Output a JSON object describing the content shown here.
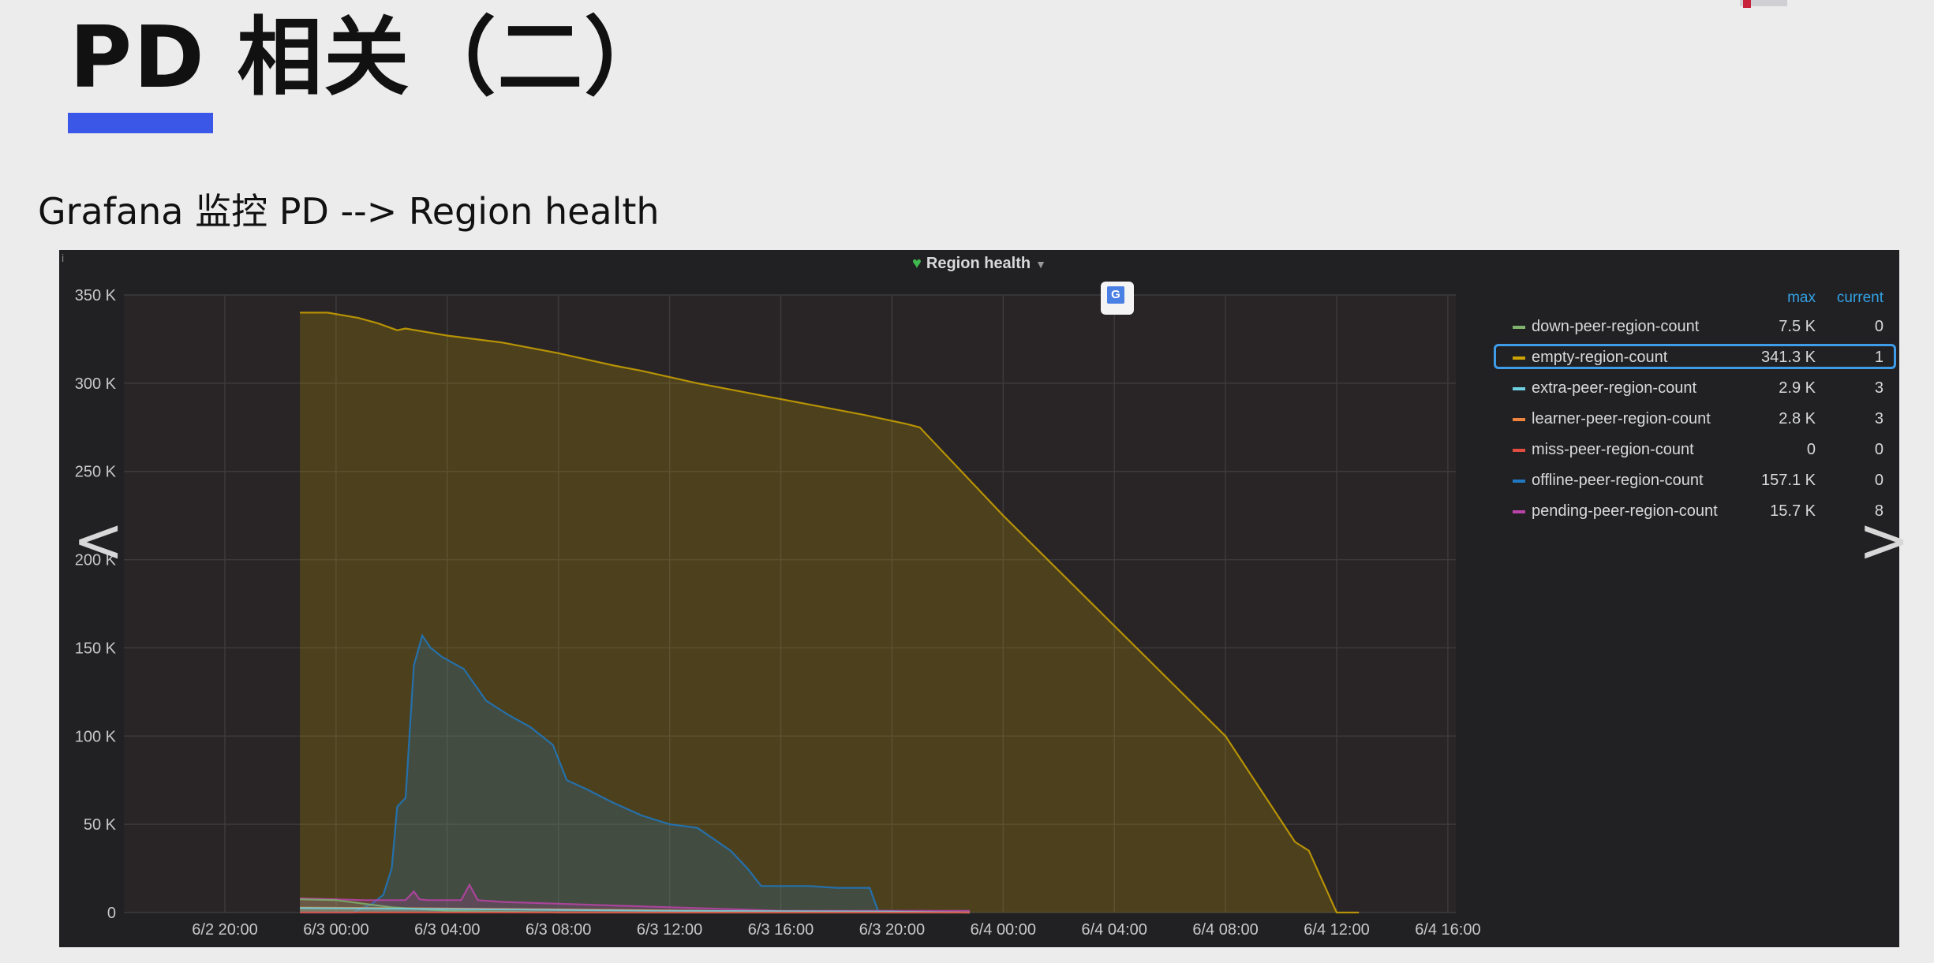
{
  "slide": {
    "title": "PD 相关（二）",
    "subtitle": "Grafana 监控 PD --> Region health"
  },
  "panel": {
    "title": "Region health",
    "legend_headers": {
      "max": "max",
      "current": "current"
    }
  },
  "chart_data": {
    "type": "area",
    "x_ticks": [
      "6/2 20:00",
      "6/3 00:00",
      "6/3 04:00",
      "6/3 08:00",
      "6/3 12:00",
      "6/3 16:00",
      "6/3 20:00",
      "6/4 00:00",
      "6/4 04:00",
      "6/4 08:00",
      "6/4 12:00",
      "6/4 16:00"
    ],
    "y_ticks": [
      "0",
      "50 K",
      "100 K",
      "150 K",
      "200 K",
      "250 K",
      "300 K",
      "350 K"
    ],
    "ylim": [
      0,
      350000
    ],
    "x_hours_range": [
      -1.3,
      22.8
    ],
    "x_origin_label": "6/3 00:00",
    "series": [
      {
        "name": "down-peer-region-count",
        "color": "#7eb26d",
        "max": "7.5 K",
        "current": "0",
        "points": [
          [
            -1.3,
            7500
          ],
          [
            0,
            7000
          ],
          [
            2,
            3000
          ],
          [
            4,
            1000
          ],
          [
            6,
            500
          ],
          [
            8,
            0
          ],
          [
            22.8,
            0
          ]
        ]
      },
      {
        "name": "empty-region-count",
        "color": "#cca300",
        "max": "341.3 K",
        "current": "1",
        "selected": true,
        "points": [
          [
            -1.3,
            340000
          ],
          [
            -0.3,
            340000
          ],
          [
            0.8,
            337000
          ],
          [
            1.5,
            334000
          ],
          [
            2.2,
            330000
          ],
          [
            2.5,
            331000
          ],
          [
            4,
            327000
          ],
          [
            6,
            323000
          ],
          [
            8,
            317000
          ],
          [
            10,
            310000
          ],
          [
            11,
            307000
          ],
          [
            13,
            300000
          ],
          [
            15,
            294000
          ],
          [
            17,
            288000
          ],
          [
            19,
            282000
          ],
          [
            20.5,
            277000
          ],
          [
            21,
            275000
          ],
          [
            24,
            225000
          ],
          [
            32,
            100000
          ],
          [
            34.5,
            40000
          ],
          [
            35,
            35000
          ],
          [
            36,
            0
          ],
          [
            36.8,
            0
          ]
        ]
      },
      {
        "name": "extra-peer-region-count",
        "color": "#6ed0e0",
        "max": "2.9 K",
        "current": "3",
        "points": [
          [
            -1.3,
            2500
          ],
          [
            4,
            2000
          ],
          [
            8,
            1500
          ],
          [
            12,
            1000
          ],
          [
            20,
            500
          ],
          [
            22.8,
            0
          ]
        ]
      },
      {
        "name": "learner-peer-region-count",
        "color": "#ef843c",
        "max": "2.8 K",
        "current": "3",
        "points": [
          [
            -1.3,
            2800
          ],
          [
            2,
            2500
          ],
          [
            6,
            2000
          ],
          [
            10,
            1500
          ],
          [
            14,
            800
          ],
          [
            20,
            400
          ],
          [
            22.8,
            0
          ]
        ]
      },
      {
        "name": "miss-peer-region-count",
        "color": "#e24d42",
        "max": "0",
        "current": "0",
        "points": [
          [
            -1.3,
            0
          ],
          [
            22.8,
            0
          ]
        ]
      },
      {
        "name": "offline-peer-region-count",
        "color": "#1f78c1",
        "max": "157.1 K",
        "current": "0",
        "points": [
          [
            -1.3,
            0
          ],
          [
            0.6,
            0
          ],
          [
            1.3,
            5000
          ],
          [
            1.7,
            10000
          ],
          [
            2,
            25000
          ],
          [
            2.2,
            60000
          ],
          [
            2.5,
            65000
          ],
          [
            2.8,
            140000
          ],
          [
            3.1,
            157000
          ],
          [
            3.4,
            150000
          ],
          [
            3.8,
            145000
          ],
          [
            4.6,
            138000
          ],
          [
            5.4,
            120000
          ],
          [
            6.2,
            112000
          ],
          [
            7,
            105000
          ],
          [
            7.8,
            95000
          ],
          [
            8.3,
            75000
          ],
          [
            9,
            70000
          ],
          [
            10,
            62000
          ],
          [
            11,
            55000
          ],
          [
            12,
            50000
          ],
          [
            13,
            48000
          ],
          [
            14.2,
            35000
          ],
          [
            14.8,
            25000
          ],
          [
            15.3,
            15000
          ],
          [
            17,
            15000
          ],
          [
            18,
            14000
          ],
          [
            19.2,
            14000
          ],
          [
            19.5,
            1000
          ],
          [
            22.8,
            0
          ]
        ]
      },
      {
        "name": "pending-peer-region-count",
        "color": "#ba43a9",
        "max": "15.7 K",
        "current": "8",
        "points": [
          [
            -1.3,
            8000
          ],
          [
            0,
            7500
          ],
          [
            1,
            7000
          ],
          [
            2.5,
            7000
          ],
          [
            2.8,
            12000
          ],
          [
            3,
            7500
          ],
          [
            3.3,
            7000
          ],
          [
            4.5,
            7000
          ],
          [
            4.8,
            15700
          ],
          [
            5.1,
            7000
          ],
          [
            6,
            6000
          ],
          [
            8,
            5000
          ],
          [
            10,
            4000
          ],
          [
            12,
            3000
          ],
          [
            14,
            2000
          ],
          [
            16,
            1000
          ],
          [
            22.8,
            1000
          ]
        ]
      }
    ]
  }
}
